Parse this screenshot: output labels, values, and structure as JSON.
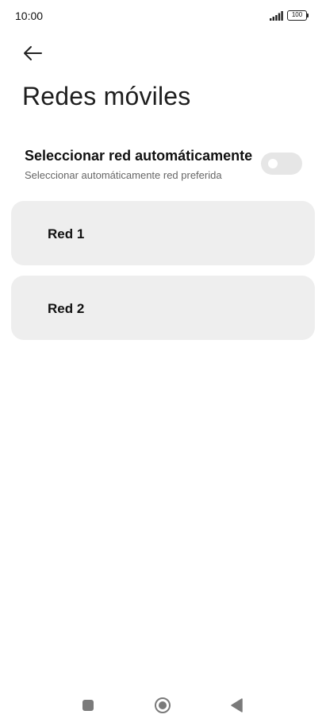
{
  "status_bar": {
    "time": "10:00",
    "battery": "100",
    "icons": [
      "signal-icon",
      "battery-icon"
    ]
  },
  "header": {
    "back_icon": "back-arrow-icon",
    "title": "Redes móviles"
  },
  "auto_select": {
    "title": "Seleccionar red automáticamente",
    "subtitle": "Seleccionar automáticamente red preferida",
    "enabled": false
  },
  "networks": [
    {
      "label": "Red 1"
    },
    {
      "label": "Red 2"
    }
  ],
  "nav_bar": {
    "icons": [
      "recents-icon",
      "home-icon",
      "back-icon"
    ]
  },
  "colors": {
    "card_background": "#eeeeee",
    "toggle_off": "#e6e6e6",
    "text_primary": "#111111",
    "text_secondary": "#666666"
  }
}
